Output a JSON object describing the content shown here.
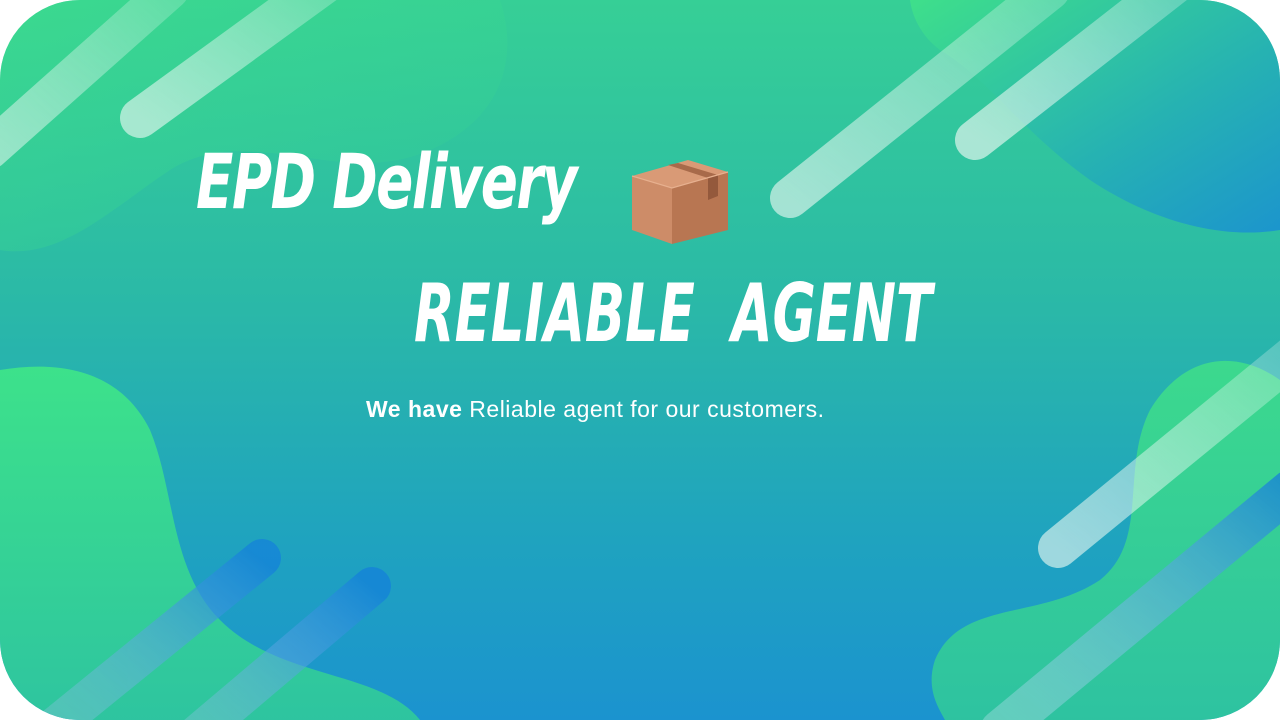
{
  "banner": {
    "title": "EPD Delivery",
    "icon": "package-box-icon",
    "subtitle": "RELIABLE  AGENT",
    "tagline_bold": "We have",
    "tagline_rest": " Reliable agent for our customers."
  },
  "colors": {
    "background_top": "#36cf96",
    "background_bottom": "#1b93cf",
    "blob_green": "#3fe08a",
    "text": "#ffffff",
    "box": "#c98a67"
  }
}
